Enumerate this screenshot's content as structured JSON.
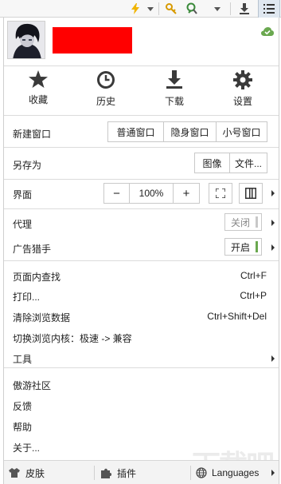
{
  "toolbar": {
    "icons": [
      "lightning-icon",
      "dropdown-arrow-icon",
      "key-icon",
      "magnifier-icon",
      "dropdown-arrow-icon",
      "download-icon",
      "menu-icon"
    ]
  },
  "profile": {
    "status_icon": "cloud-check-icon"
  },
  "quick_actions": [
    {
      "label": "收藏",
      "icon": "star-icon"
    },
    {
      "label": "历史",
      "icon": "clock-icon"
    },
    {
      "label": "下载",
      "icon": "download-icon"
    },
    {
      "label": "设置",
      "icon": "gear-icon"
    }
  ],
  "new_window": {
    "label": "新建窗口",
    "options": [
      "普通窗口",
      "隐身窗口",
      "小号窗口"
    ]
  },
  "save_as": {
    "label": "另存为",
    "options": [
      "图像",
      "文件..."
    ]
  },
  "interface": {
    "label": "界面",
    "zoom_out": "−",
    "zoom": "100%",
    "zoom_in": "+"
  },
  "proxy": {
    "label": "代理",
    "state": "关闭"
  },
  "ad_killer": {
    "label": "广告猎手",
    "state": "开启"
  },
  "menu": {
    "find": {
      "label": "页面内查找",
      "shortcut": "Ctrl+F"
    },
    "print": {
      "label": "打印...",
      "shortcut": "Ctrl+P"
    },
    "clear": {
      "label": "清除浏览数据",
      "shortcut": "Ctrl+Shift+Del"
    },
    "kernel": {
      "label": "切换浏览内核：极速 -> 兼容"
    },
    "tools": {
      "label": "工具"
    },
    "community": {
      "label": "傲游社区"
    },
    "feedback": {
      "label": "反馈"
    },
    "help": {
      "label": "帮助"
    },
    "about": {
      "label": "关于..."
    }
  },
  "bottom": {
    "skin": "皮肤",
    "plugins": "插件",
    "languages": "Languages"
  },
  "watermark": "下载吧",
  "colors": {
    "accent_green": "#6aa84f",
    "name_block": "#ff0000"
  }
}
